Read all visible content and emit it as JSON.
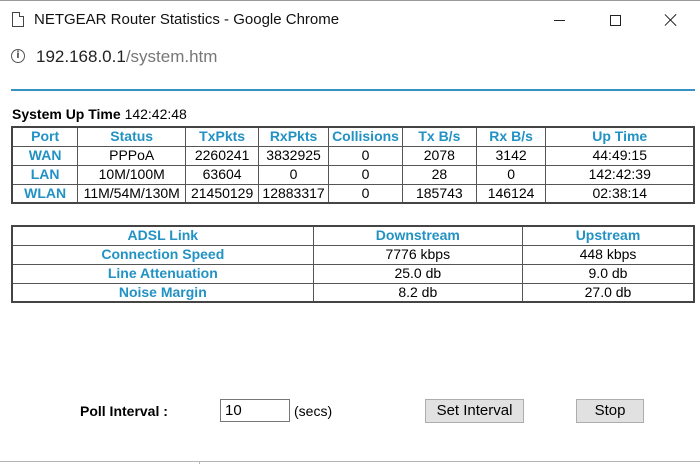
{
  "window": {
    "title": "NETGEAR Router Statistics - Google Chrome",
    "icons": {
      "page": "page-icon",
      "minimize": "minimize-icon",
      "maximize": "maximize-icon",
      "close": "close-icon"
    }
  },
  "address_bar": {
    "host": "192.168.0.1",
    "path": "/system.htm",
    "icon": "info-icon"
  },
  "system": {
    "uptime_label": "System Up Time",
    "uptime_value": "142:42:48"
  },
  "stats_table": {
    "headers": [
      "Port",
      "Status",
      "TxPkts",
      "RxPkts",
      "Collisions",
      "Tx B/s",
      "Rx B/s",
      "Up Time"
    ],
    "rows": [
      [
        "WAN",
        "PPPoA",
        "2260241",
        "3832925",
        "0",
        "2078",
        "3142",
        "44:49:15"
      ],
      [
        "LAN",
        "10M/100M",
        "63604",
        "0",
        "0",
        "28",
        "0",
        "142:42:39"
      ],
      [
        "WLAN",
        "11M/54M/130M",
        "21450129",
        "12883317",
        "0",
        "185743",
        "146124",
        "02:38:14"
      ]
    ]
  },
  "adsl_table": {
    "headers": [
      "ADSL Link",
      "Downstream",
      "Upstream"
    ],
    "rows": [
      [
        "Connection Speed",
        "7776 kbps",
        "448 kbps"
      ],
      [
        "Line Attenuation",
        "25.0 db",
        "9.0 db"
      ],
      [
        "Noise Margin",
        "8.2 db",
        "27.0 db"
      ]
    ]
  },
  "poll": {
    "label": "Poll Interval :",
    "value": "10",
    "unit": "(secs)",
    "set_button": "Set Interval",
    "stop_button": "Stop"
  },
  "colors": {
    "accent": "#3592c4",
    "header_text": "#2292c4"
  }
}
